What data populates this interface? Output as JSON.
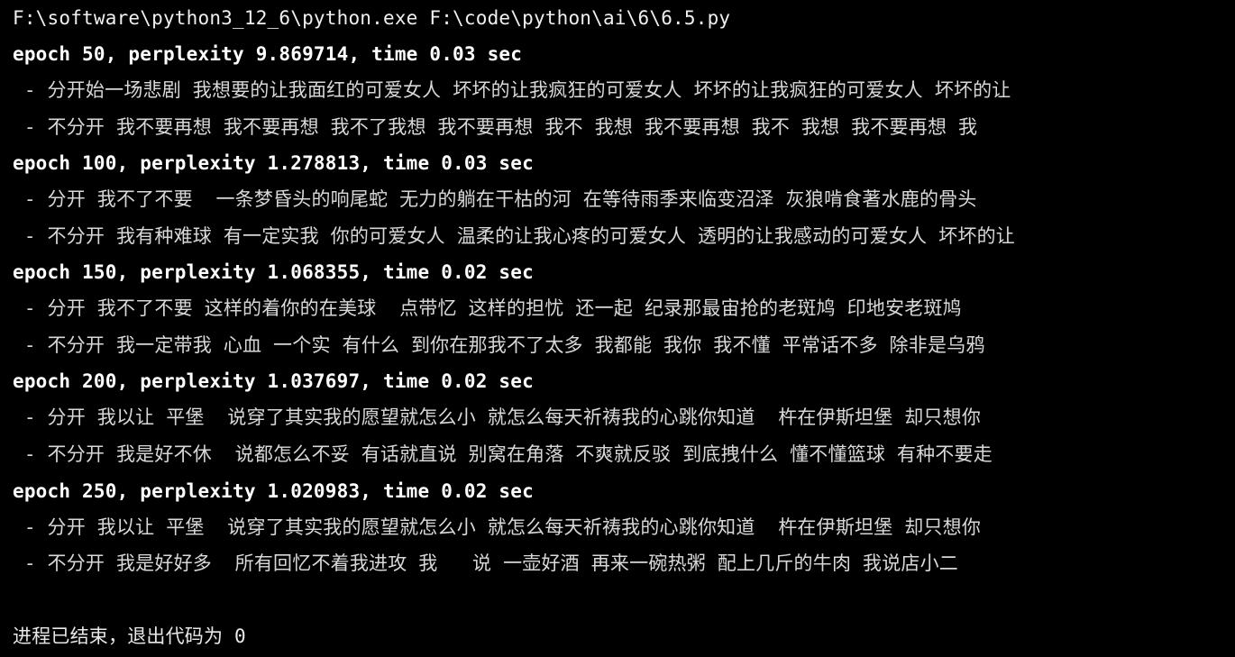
{
  "console": {
    "command": "F:\\software\\python3_12_6\\python.exe F:\\code\\python\\ai\\6\\6.5.py",
    "epochs": [
      {
        "header": "epoch 50, perplexity 9.869714, time 0.03 sec",
        "samples": [
          " - 分开始一场悲剧 我想要的让我面红的可爱女人 坏坏的让我疯狂的可爱女人 坏坏的让我疯狂的可爱女人 坏坏的让",
          " - 不分开 我不要再想 我不要再想 我不了我想 我不要再想 我不 我想 我不要再想 我不 我想 我不要再想 我"
        ]
      },
      {
        "header": "epoch 100, perplexity 1.278813, time 0.03 sec",
        "samples": [
          " - 分开 我不了不要  一条梦昏头的响尾蛇 无力的躺在干枯的河 在等待雨季来临变沼泽 灰狼啃食著水鹿的骨头",
          " - 不分开 我有种难球 有一定实我 你的可爱女人 温柔的让我心疼的可爱女人 透明的让我感动的可爱女人 坏坏的让"
        ]
      },
      {
        "header": "epoch 150, perplexity 1.068355, time 0.02 sec",
        "samples": [
          " - 分开 我不了不要 这样的着你的在美球  点带忆 这样的担忧 还一起 纪录那最宙抢的老斑鸠 印地安老斑鸠",
          " - 不分开 我一定带我 心血 一个实 有什么 到你在那我不了太多 我都能 我你 我不懂 平常话不多 除非是乌鸦"
        ]
      },
      {
        "header": "epoch 200, perplexity 1.037697, time 0.02 sec",
        "samples": [
          " - 分开 我以让 平堡  说穿了其实我的愿望就怎么小 就怎么每天祈祷我的心跳你知道  杵在伊斯坦堡 却只想你",
          " - 不分开 我是好不休  说都怎么不妥 有话就直说 别窝在角落 不爽就反驳 到底拽什么 懂不懂篮球 有种不要走"
        ]
      },
      {
        "header": "epoch 250, perplexity 1.020983, time 0.02 sec",
        "samples": [
          " - 分开 我以让 平堡  说穿了其实我的愿望就怎么小 就怎么每天祈祷我的心跳你知道  杵在伊斯坦堡 却只想你",
          " - 不分开 我是好好多  所有回忆不着我进攻 我   说 一壶好酒 再来一碗热粥 配上几斤的牛肉 我说店小二"
        ]
      }
    ],
    "exit_message": "进程已结束，退出代码为 0"
  }
}
